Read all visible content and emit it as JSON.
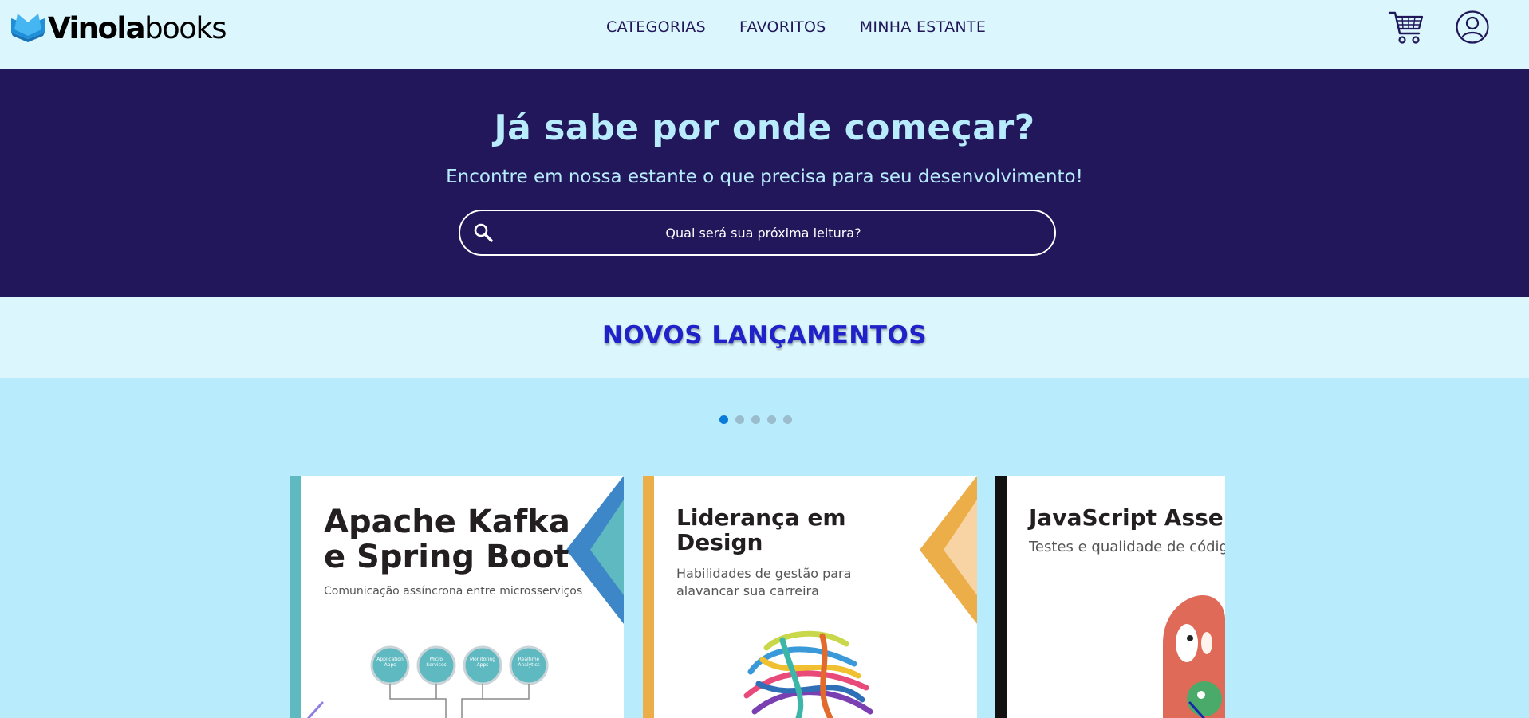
{
  "logo": {
    "part1": "Vinola",
    "part2": "books"
  },
  "nav": {
    "items": [
      "CATEGORIAS",
      "FAVORITOS",
      "MINHA ESTANTE"
    ]
  },
  "icons": {
    "cart": "cart-icon",
    "user": "user-icon",
    "search": "search-icon",
    "logo": "open-book-icon"
  },
  "hero": {
    "title": "Já sabe por onde começar?",
    "subtitle": "Encontre em nossa estante o que precisa para seu desenvolvimento!",
    "search_placeholder": "Qual será sua próxima leitura?",
    "search_value": ""
  },
  "section": {
    "title": "NOVOS LANÇAMENTOS"
  },
  "carousel": {
    "dot_count": 5,
    "active_index": 0,
    "books": [
      {
        "title": "Apache Kafka\ne Spring Boot",
        "subtitle": "Comunicação assíncrona entre microsserviços",
        "accent": "#5fb9c0"
      },
      {
        "title": "Liderança em\nDesign",
        "subtitle": "Habilidades de gestão para\nalavancar sua carreira",
        "accent": "#ecae49"
      },
      {
        "title": "JavaScript Asserti",
        "subtitle": "Testes e qualidade de código\nem todas as camadas da aplica",
        "accent": "#111111"
      }
    ],
    "kafka_nodes": [
      "Application\nApps",
      "Micro\nServices",
      "Monitoring\nApps",
      "Realtime\nAnalytics"
    ]
  },
  "colors": {
    "header_bg": "#dbf6fd",
    "hero_bg": "#21175a",
    "hero_text": "#b8ebfb",
    "section_title": "#2121c9",
    "page_bg": "#b8ebfb",
    "dot_active": "#0b7bd8",
    "dot_inactive": "#9bbccc"
  }
}
